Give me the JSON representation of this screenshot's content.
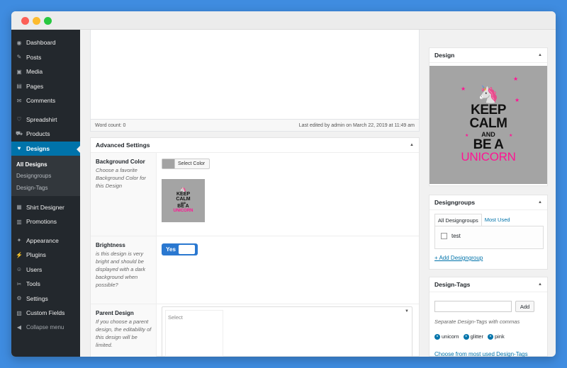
{
  "sidebar": {
    "items": [
      {
        "icon": "dashboard-icon",
        "glyph": "◉",
        "label": "Dashboard"
      },
      {
        "icon": "pushpin-icon",
        "glyph": "✎",
        "label": "Posts"
      },
      {
        "icon": "media-icon",
        "glyph": "▣",
        "label": "Media"
      },
      {
        "icon": "pages-icon",
        "glyph": "▤",
        "label": "Pages"
      },
      {
        "icon": "comments-icon",
        "glyph": "✉",
        "label": "Comments"
      },
      {
        "icon": "heart-icon",
        "glyph": "♡",
        "label": "Spreadshirt"
      },
      {
        "icon": "cart-icon",
        "glyph": "⛟",
        "label": "Products"
      },
      {
        "icon": "designs-icon",
        "glyph": "♥",
        "label": "Designs"
      }
    ],
    "submenu": [
      "All Designs",
      "Designgroups",
      "Design-Tags"
    ],
    "items2": [
      {
        "icon": "shirt-designer-icon",
        "glyph": "▦",
        "label": "Shirt Designer"
      },
      {
        "icon": "promotions-icon",
        "glyph": "▥",
        "label": "Promotions"
      }
    ],
    "items3": [
      {
        "icon": "appearance-icon",
        "glyph": "✦",
        "label": "Appearance"
      },
      {
        "icon": "plugins-icon",
        "glyph": "⚡",
        "label": "Plugins"
      },
      {
        "icon": "users-icon",
        "glyph": "☺",
        "label": "Users"
      },
      {
        "icon": "tools-icon",
        "glyph": "✂",
        "label": "Tools"
      },
      {
        "icon": "settings-icon",
        "glyph": "⚙",
        "label": "Settings"
      },
      {
        "icon": "custom-fields-icon",
        "glyph": "▧",
        "label": "Custom Fields"
      }
    ],
    "collapse_label": "Collapse menu"
  },
  "editor": {
    "word_count": "Word count: 0",
    "last_edited": "Last edited by admin on March 22, 2019 at 11:49 am"
  },
  "advanced": {
    "title": "Advanced Settings",
    "background_color": {
      "label": "Background Color",
      "desc": "Choose a favorite Background Color for this Design",
      "button": "Select Color",
      "swatch": "#a3a3a3"
    },
    "brightness": {
      "label": "Brightness",
      "desc": "is this design is very bright and should be displayed with a dark background when possible?",
      "toggle": "Yes"
    },
    "parent": {
      "label": "Parent Design",
      "desc": "If you choose a parent design, the editability of this design will be limited.",
      "placeholder": "Select"
    }
  },
  "design_art": {
    "line1": "KEEP",
    "line2": "CALM",
    "line3": "AND",
    "line4": "BE A",
    "line5": "UNICORN",
    "unicorn": "🦄"
  },
  "design_box": {
    "title": "Design"
  },
  "designgroups": {
    "title": "Designgroups",
    "tab_all": "All Designgroups",
    "tab_used": "Most Used",
    "items": [
      "test"
    ],
    "add_link": "+ Add Designgroup"
  },
  "design_tags": {
    "title": "Design-Tags",
    "add_button": "Add",
    "hint": "Separate Design-Tags with commas",
    "tags": [
      "unicorn",
      "glitter",
      "pink"
    ],
    "choose_link": "Choose from most used Design-Tags"
  },
  "colors": {
    "accent": "#0073aa",
    "toggle": "#2a78d0",
    "pink": "#ff1493",
    "sidebar": "#23282d"
  }
}
